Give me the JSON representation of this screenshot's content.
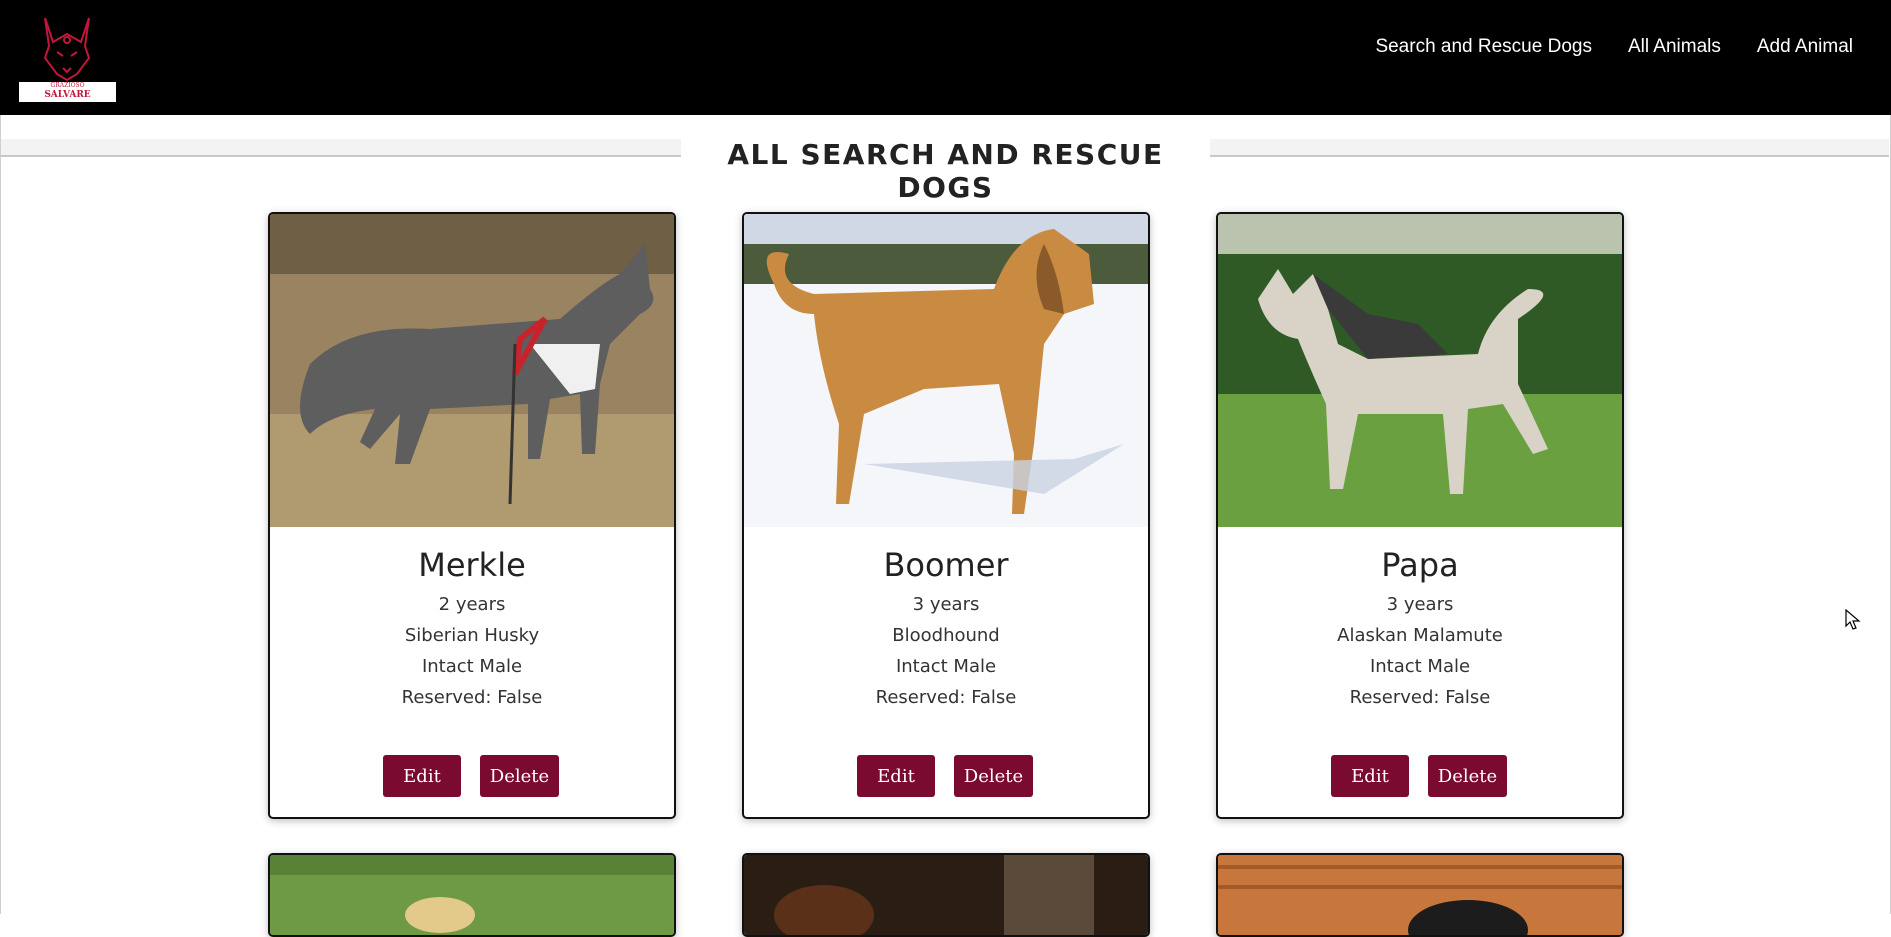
{
  "logo": {
    "line1": "GRAZIOSO",
    "line2": "SALVARE"
  },
  "nav": [
    {
      "label": "Search and Rescue Dogs"
    },
    {
      "label": "All Animals"
    },
    {
      "label": "Add Animal"
    }
  ],
  "page_title": "ALL SEARCH AND RESCUE DOGS",
  "cards": [
    {
      "name": "Merkle",
      "age": "2 years",
      "breed": "Siberian Husky",
      "sex": "Intact Male",
      "reserved": "Reserved: False",
      "edit": "Edit",
      "delete": "Delete"
    },
    {
      "name": "Boomer",
      "age": "3 years",
      "breed": "Bloodhound",
      "sex": "Intact Male",
      "reserved": "Reserved: False",
      "edit": "Edit",
      "delete": "Delete"
    },
    {
      "name": "Papa",
      "age": "3 years",
      "breed": "Alaskan Malamute",
      "sex": "Intact Male",
      "reserved": "Reserved: False",
      "edit": "Edit",
      "delete": "Delete"
    }
  ],
  "colors": {
    "header_bg": "#000000",
    "button": "#7a0a30",
    "logo_red": "#c2163a"
  },
  "icons": [
    "dog-head-logo-icon",
    "mouse-pointer-icon"
  ]
}
